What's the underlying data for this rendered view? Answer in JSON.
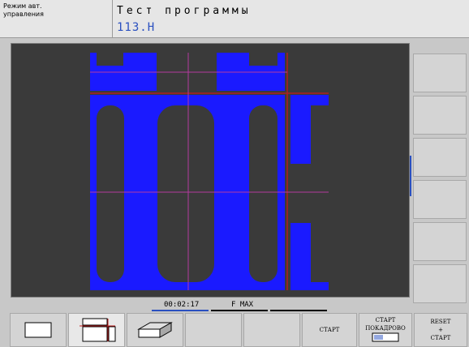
{
  "header": {
    "mode_line1": "Режим авт.",
    "mode_line2": "управления",
    "title": "Тест программы",
    "file": "113.H"
  },
  "status": {
    "time": "00:02:17",
    "feed": "F MAX"
  },
  "softkeys": {
    "start": "СТАРТ",
    "start_single_line1": "СТАРТ",
    "start_single_line2": "ПОКАДРОВО",
    "reset_line1": "RESET",
    "reset_line2": "+",
    "reset_line3": "СТАРТ"
  },
  "icons": {
    "view_top": "plan-view-icon",
    "view_three_planes": "three-planes-view-icon",
    "view_3d": "3d-view-icon"
  },
  "colors": {
    "workpiece": "#1a1aff",
    "background": "#3a3a3a",
    "cursor_lines": "#b4399f",
    "section_lines": "#b02020",
    "accent": "#2a50c0"
  }
}
